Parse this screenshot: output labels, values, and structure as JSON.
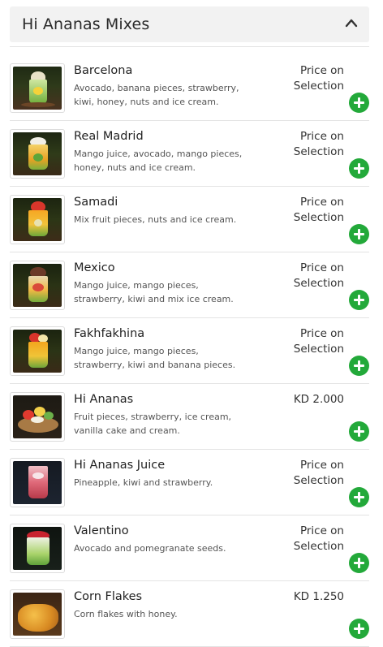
{
  "section": {
    "title": "Hi Ananas Mixes"
  },
  "items": [
    {
      "name": "Barcelona",
      "description": "Avocado, banana pieces, strawberry, kiwi, honey, nuts and ice cream.",
      "price": "Price on Selection",
      "image": "barcelona-drink"
    },
    {
      "name": "Real Madrid",
      "description": "Mango juice, avocado, mango pieces, honey, nuts and ice cream.",
      "price": "Price on Selection",
      "image": "real-madrid-drink"
    },
    {
      "name": "Samadi",
      "description": "Mix fruit pieces, nuts and ice cream.",
      "price": "Price on Selection",
      "image": "samadi-drink"
    },
    {
      "name": "Mexico",
      "description": "Mango juice, mango pieces, strawberry, kiwi and mix ice cream.",
      "price": "Price on Selection",
      "image": "mexico-drink"
    },
    {
      "name": "Fakhfakhina",
      "description": "Mango juice, mango pieces, strawberry, kiwi and banana pieces.",
      "price": "Price on Selection",
      "image": "fakhfakhina-drink"
    },
    {
      "name": "Hi Ananas",
      "description": "Fruit pieces, strawberry, ice cream, vanilla cake and cream.",
      "price": "KD 2.000",
      "image": "hi-ananas-platter"
    },
    {
      "name": "Hi Ananas Juice",
      "description": "Pineapple, kiwi and strawberry.",
      "price": "Price on Selection",
      "image": "hi-ananas-juice"
    },
    {
      "name": "Valentino",
      "description": "Avocado and pomegranate seeds.",
      "price": "Price on Selection",
      "image": "valentino-drink"
    },
    {
      "name": "Corn Flakes",
      "description": "Corn flakes with honey.",
      "price": "KD 1.250",
      "image": "corn-flakes-bowl"
    }
  ],
  "colors": {
    "add_button": "#23a93a",
    "header_bg": "#f2f2f2"
  }
}
